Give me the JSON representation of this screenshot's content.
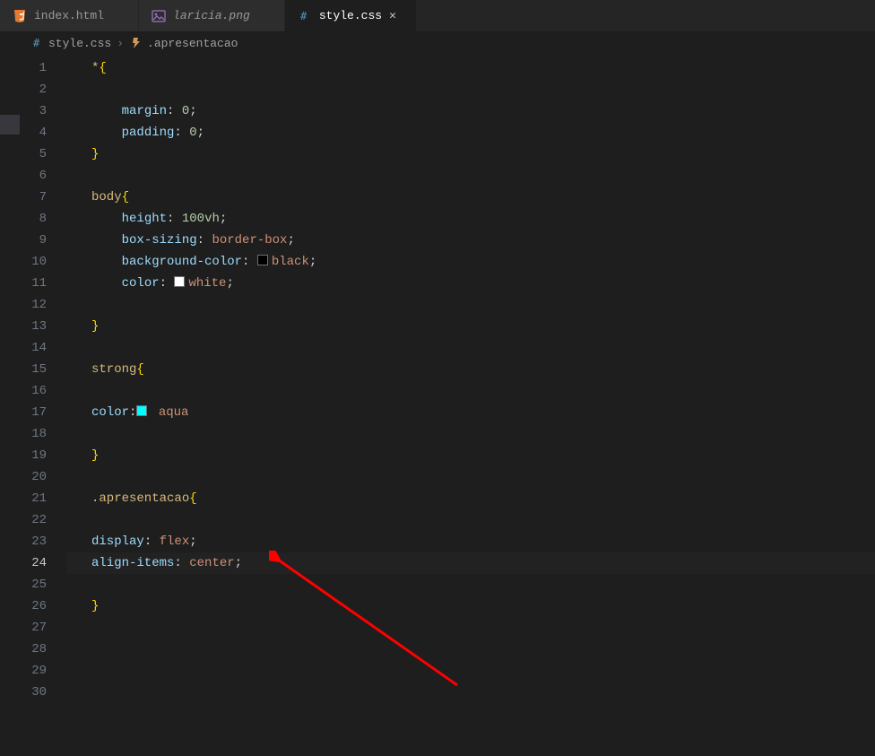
{
  "tabs": [
    {
      "label": "index.html",
      "icon": "html",
      "active": false,
      "italic": false
    },
    {
      "label": "laricia.png",
      "icon": "image",
      "active": false,
      "italic": true
    },
    {
      "label": "style.css",
      "icon": "css",
      "active": true,
      "italic": false
    }
  ],
  "breadcrumbs": [
    {
      "label": "style.css",
      "icon": "css"
    },
    {
      "label": ".apresentacao",
      "icon": "symbol"
    }
  ],
  "currentLine": 24,
  "code": [
    {
      "n": 1,
      "indent": 0,
      "tokens": [
        {
          "t": "*",
          "c": "sel"
        },
        {
          "t": "{",
          "c": "brace"
        }
      ]
    },
    {
      "n": 2,
      "indent": 0,
      "tokens": []
    },
    {
      "n": 3,
      "indent": 1,
      "tokens": [
        {
          "t": "margin",
          "c": "prop"
        },
        {
          "t": ": ",
          "c": "pun"
        },
        {
          "t": "0",
          "c": "num"
        },
        {
          "t": ";",
          "c": "pun"
        }
      ]
    },
    {
      "n": 4,
      "indent": 1,
      "tokens": [
        {
          "t": "padding",
          "c": "prop"
        },
        {
          "t": ": ",
          "c": "pun"
        },
        {
          "t": "0",
          "c": "num"
        },
        {
          "t": ";",
          "c": "pun"
        }
      ]
    },
    {
      "n": 5,
      "indent": 0,
      "tokens": [
        {
          "t": "}",
          "c": "brace"
        }
      ]
    },
    {
      "n": 6,
      "indent": 0,
      "tokens": []
    },
    {
      "n": 7,
      "indent": 0,
      "tokens": [
        {
          "t": "body",
          "c": "sel"
        },
        {
          "t": "{",
          "c": "brace"
        }
      ]
    },
    {
      "n": 8,
      "indent": 1,
      "tokens": [
        {
          "t": "height",
          "c": "prop"
        },
        {
          "t": ": ",
          "c": "pun"
        },
        {
          "t": "100",
          "c": "num"
        },
        {
          "t": "vh",
          "c": "num"
        },
        {
          "t": ";",
          "c": "pun"
        }
      ]
    },
    {
      "n": 9,
      "indent": 1,
      "tokens": [
        {
          "t": "box-sizing",
          "c": "prop"
        },
        {
          "t": ": ",
          "c": "pun"
        },
        {
          "t": "border-box",
          "c": "val"
        },
        {
          "t": ";",
          "c": "pun"
        }
      ]
    },
    {
      "n": 10,
      "indent": 1,
      "tokens": [
        {
          "t": "background-color",
          "c": "prop"
        },
        {
          "t": ": ",
          "c": "pun"
        },
        {
          "swatch": "#000000"
        },
        {
          "t": "black",
          "c": "colorname"
        },
        {
          "t": ";",
          "c": "pun"
        }
      ]
    },
    {
      "n": 11,
      "indent": 1,
      "tokens": [
        {
          "t": "color",
          "c": "prop"
        },
        {
          "t": ": ",
          "c": "pun"
        },
        {
          "swatch": "#ffffff"
        },
        {
          "t": "white",
          "c": "colorname"
        },
        {
          "t": ";",
          "c": "pun"
        }
      ]
    },
    {
      "n": 12,
      "indent": 1,
      "tokens": []
    },
    {
      "n": 13,
      "indent": 0,
      "tokens": [
        {
          "t": "}",
          "c": "brace"
        }
      ]
    },
    {
      "n": 14,
      "indent": 0,
      "tokens": []
    },
    {
      "n": 15,
      "indent": 0,
      "tokens": [
        {
          "t": "strong",
          "c": "sel"
        },
        {
          "t": "{",
          "c": "brace"
        }
      ]
    },
    {
      "n": 16,
      "indent": 0,
      "tokens": []
    },
    {
      "n": 17,
      "indent": 0,
      "tokens": [
        {
          "t": "color",
          "c": "prop"
        },
        {
          "t": ":",
          "c": "pun"
        },
        {
          "swatch": "#00ffff"
        },
        {
          "t": " aqua",
          "c": "colorname"
        }
      ]
    },
    {
      "n": 18,
      "indent": 0,
      "tokens": []
    },
    {
      "n": 19,
      "indent": 0,
      "tokens": [
        {
          "t": "}",
          "c": "brace"
        }
      ]
    },
    {
      "n": 20,
      "indent": 0,
      "tokens": []
    },
    {
      "n": 21,
      "indent": 0,
      "tokens": [
        {
          "t": ".apresentacao",
          "c": "sel"
        },
        {
          "t": "{",
          "c": "brace"
        }
      ]
    },
    {
      "n": 22,
      "indent": 0,
      "tokens": []
    },
    {
      "n": 23,
      "indent": 0,
      "tokens": [
        {
          "t": "display",
          "c": "prop"
        },
        {
          "t": ": ",
          "c": "pun"
        },
        {
          "t": "flex",
          "c": "val"
        },
        {
          "t": ";",
          "c": "pun"
        }
      ]
    },
    {
      "n": 24,
      "indent": 0,
      "tokens": [
        {
          "t": "align-items",
          "c": "prop"
        },
        {
          "t": ": ",
          "c": "pun"
        },
        {
          "t": "center",
          "c": "val"
        },
        {
          "t": ";",
          "c": "pun"
        }
      ]
    },
    {
      "n": 25,
      "indent": 0,
      "tokens": []
    },
    {
      "n": 26,
      "indent": 0,
      "tokens": [
        {
          "t": "}",
          "c": "brace"
        }
      ]
    },
    {
      "n": 27,
      "indent": 0,
      "tokens": []
    },
    {
      "n": 28,
      "indent": 0,
      "tokens": []
    },
    {
      "n": 29,
      "indent": 0,
      "tokens": []
    },
    {
      "n": 30,
      "indent": 0,
      "tokens": []
    }
  ]
}
